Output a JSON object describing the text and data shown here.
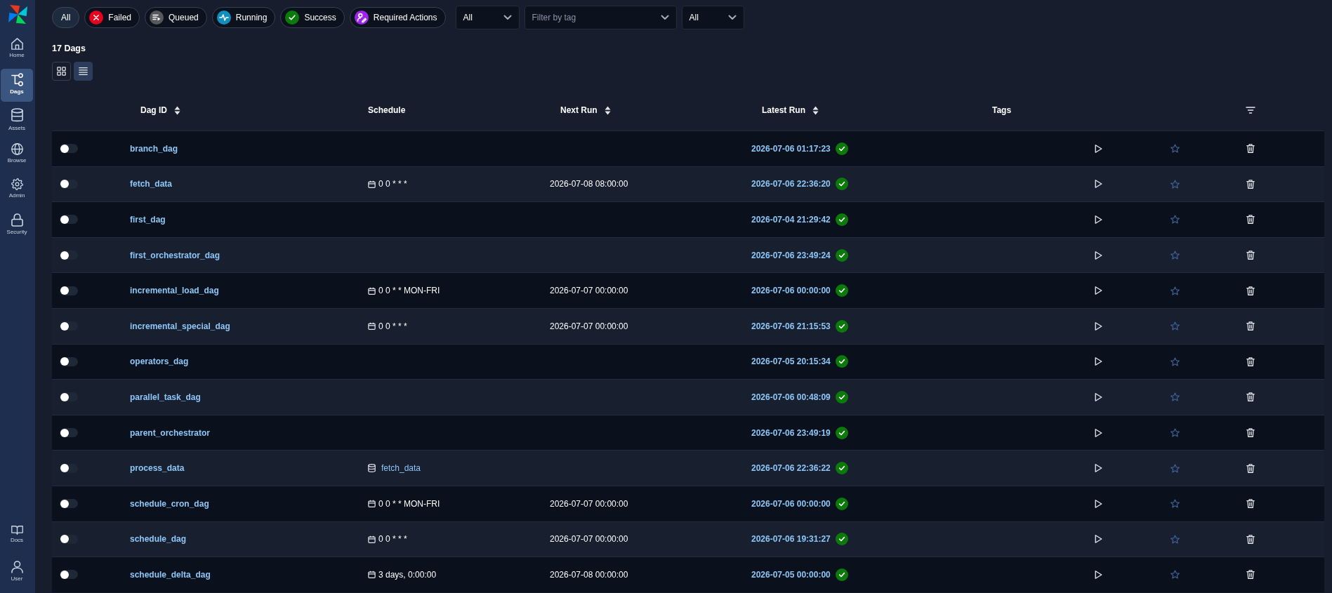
{
  "sidebar": {
    "items": [
      {
        "label": "Home",
        "selected": false
      },
      {
        "label": "Dags",
        "selected": true
      },
      {
        "label": "Assets",
        "selected": false
      },
      {
        "label": "Browse",
        "selected": false
      },
      {
        "label": "Admin",
        "selected": false
      },
      {
        "label": "Security",
        "selected": false
      }
    ],
    "footer_items": [
      {
        "label": "Docs"
      },
      {
        "label": "User"
      }
    ]
  },
  "status_filters": [
    {
      "label": "All",
      "selected": true
    },
    {
      "label": "Failed",
      "selected": false
    },
    {
      "label": "Queued",
      "selected": false
    },
    {
      "label": "Running",
      "selected": false
    },
    {
      "label": "Success",
      "selected": false
    },
    {
      "label": "Required Actions",
      "selected": false
    }
  ],
  "dropdowns": [
    {
      "value": "All"
    },
    {
      "placeholder": "Filter by tag"
    },
    {
      "value": "All"
    }
  ],
  "summary": {
    "count": "17 Dags"
  },
  "view_modes": [
    {
      "kind": "card",
      "selected": false
    },
    {
      "kind": "list",
      "selected": true
    }
  ],
  "table": {
    "columns": [
      {
        "label": "Dag ID",
        "sortable": true
      },
      {
        "label": "Schedule",
        "sortable": false
      },
      {
        "label": "Next Run",
        "sortable": true
      },
      {
        "label": "Latest Run",
        "sortable": true
      },
      {
        "label": "Tags",
        "sortable": false
      }
    ],
    "rows": [
      {
        "active": false,
        "dag_id": "branch_dag",
        "latest_run": {
          "text": "2026-07-06 01:17:23",
          "kind": "success"
        },
        "favorite": false
      },
      {
        "active": false,
        "dag_id": "fetch_data",
        "schedule": {
          "kind": "cron",
          "text": "0 0 * * *"
        },
        "next_run": "2026-07-08 08:00:00",
        "latest_run": {
          "text": "2026-07-06 22:36:20",
          "kind": "success"
        },
        "favorite": false
      },
      {
        "active": false,
        "dag_id": "first_dag",
        "latest_run": {
          "text": "2026-07-04 21:29:42",
          "kind": "success"
        },
        "favorite": false
      },
      {
        "active": false,
        "dag_id": "first_orchestrator_dag",
        "latest_run": {
          "text": "2026-07-06 23:49:24",
          "kind": "success"
        },
        "favorite": false
      },
      {
        "active": false,
        "dag_id": "incremental_load_dag",
        "schedule": {
          "kind": "cron",
          "text": "0 0 * * MON-FRI"
        },
        "next_run": "2026-07-07 00:00:00",
        "latest_run": {
          "text": "2026-07-06 00:00:00",
          "kind": "success"
        },
        "favorite": false
      },
      {
        "active": false,
        "dag_id": "incremental_special_dag",
        "schedule": {
          "kind": "cron",
          "text": "0 0 * * *"
        },
        "next_run": "2026-07-07 00:00:00",
        "latest_run": {
          "text": "2026-07-06 21:15:53",
          "kind": "success"
        },
        "favorite": false
      },
      {
        "active": false,
        "dag_id": "operators_dag",
        "latest_run": {
          "text": "2026-07-05 20:15:34",
          "kind": "success"
        },
        "favorite": false
      },
      {
        "active": false,
        "dag_id": "parallel_task_dag",
        "latest_run": {
          "text": "2026-07-06 00:48:09",
          "kind": "success"
        },
        "favorite": false
      },
      {
        "active": false,
        "dag_id": "parent_orchestrator",
        "latest_run": {
          "text": "2026-07-06 23:49:19",
          "kind": "success"
        },
        "favorite": false
      },
      {
        "active": false,
        "dag_id": "process_data",
        "schedule": {
          "kind": "asset",
          "text": "fetch_data"
        },
        "latest_run": {
          "text": "2026-07-06 22:36:22",
          "kind": "success"
        },
        "favorite": false
      },
      {
        "active": false,
        "dag_id": "schedule_cron_dag",
        "schedule": {
          "kind": "cron",
          "text": "0 0 * * MON-FRI"
        },
        "next_run": "2026-07-07 00:00:00",
        "latest_run": {
          "text": "2026-07-06 00:00:00",
          "kind": "success"
        },
        "favorite": false
      },
      {
        "active": false,
        "dag_id": "schedule_dag",
        "schedule": {
          "kind": "cron",
          "text": "0 0 * * *"
        },
        "next_run": "2026-07-07 00:00:00",
        "latest_run": {
          "text": "2026-07-06 19:31:27",
          "kind": "success"
        },
        "favorite": false
      },
      {
        "active": false,
        "dag_id": "schedule_delta_dag",
        "schedule": {
          "kind": "cron",
          "text": "3 days, 0:00:00"
        },
        "next_run": "2026-07-08 00:00:00",
        "latest_run": {
          "text": "2026-07-05 00:00:00",
          "kind": "success"
        },
        "favorite": false
      }
    ]
  }
}
